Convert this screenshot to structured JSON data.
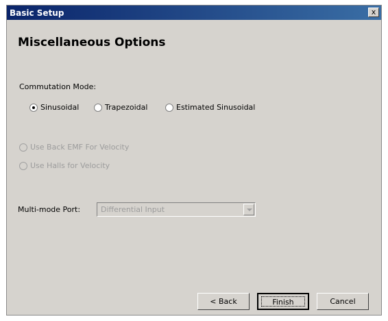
{
  "window": {
    "title": "Basic Setup",
    "close_glyph": "x"
  },
  "page": {
    "heading": "Miscellaneous Options"
  },
  "commutation": {
    "label": "Commutation Mode:",
    "options": [
      {
        "label": "Sinusoidal",
        "checked": true
      },
      {
        "label": "Trapezoidal",
        "checked": false
      },
      {
        "label": "Estimated Sinusoidal",
        "checked": false
      }
    ]
  },
  "velocity_options": [
    {
      "label": "Use Back EMF For Velocity",
      "enabled": false
    },
    {
      "label": "Use Halls for Velocity",
      "enabled": false
    }
  ],
  "multimode": {
    "label": "Multi-mode Port:",
    "value": "Differential Input",
    "enabled": false
  },
  "buttons": {
    "back": "< Back",
    "finish": "Finish",
    "cancel": "Cancel"
  }
}
